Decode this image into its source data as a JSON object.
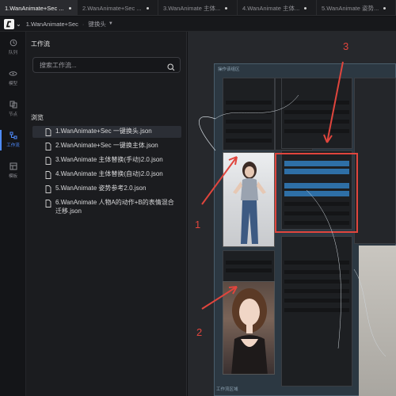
{
  "tabs": [
    {
      "label": "1.WanAnimate+Sec ..."
    },
    {
      "label": "2.WanAnimate+Sec ..."
    },
    {
      "label": "3.WanAnimate 主体..."
    },
    {
      "label": "4.WanAnimate 主体..."
    },
    {
      "label": "5.WanAnimate 姿势..."
    }
  ],
  "toolbar": {
    "breadcrumb": "1.WanAnimate+Sec",
    "sub": "键换头",
    "separator": "·"
  },
  "rail": {
    "items": [
      {
        "label": "队列",
        "icon": "history-icon"
      },
      {
        "label": "模型",
        "icon": "model-icon"
      },
      {
        "label": "节点",
        "icon": "nodes-icon"
      },
      {
        "label": "工作流",
        "icon": "workflow-icon",
        "active": true
      },
      {
        "label": "模板",
        "icon": "template-icon"
      }
    ]
  },
  "panel": {
    "title": "工作流",
    "search_placeholder": "搜索工作流...",
    "browse_label": "浏览",
    "files": [
      "1.WanAnimate+Sec 一键换头.json",
      "2.WanAnimate+Sec 一键换主体.json",
      "3.WanAnimate 主体替换(手动)2.0.json",
      "4.WanAnimate 主体替换(自动)2.0.json",
      "5.WanAnimate 姿势参考2.0.json",
      "6.WanAnimate 人物A的动作+B的表情混合迁移.json"
    ]
  },
  "canvas": {
    "group_title": "操作该组区",
    "group2_title": "工作流区域",
    "annotations": [
      "1",
      "2",
      "3"
    ]
  },
  "colors": {
    "accent": "#4f8cff",
    "annotation": "#e0453d",
    "node_blue": "#2e6fa6"
  }
}
